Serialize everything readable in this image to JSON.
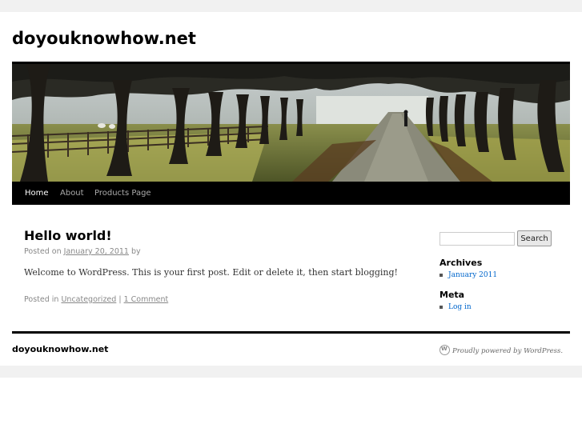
{
  "site": {
    "title": "doyouknowhow.net"
  },
  "nav": {
    "items": [
      {
        "label": "Home",
        "current": true
      },
      {
        "label": "About",
        "current": false
      },
      {
        "label": "Products Page",
        "current": false
      }
    ]
  },
  "post": {
    "title": "Hello world!",
    "posted_on_prefix": "Posted on",
    "date": "January 20, 2011",
    "by": "by",
    "body": "Welcome to WordPress. This is your first post. Edit or delete it, then start blogging!",
    "posted_in_prefix": "Posted in",
    "category": "Uncategorized",
    "separator": "|",
    "comments": "1 Comment"
  },
  "sidebar": {
    "search_button": "Search",
    "search_value": "",
    "archives_title": "Archives",
    "archives": [
      "January 2011"
    ],
    "meta_title": "Meta",
    "meta_links": [
      "Log in"
    ]
  },
  "footer": {
    "site_title": "doyouknowhow.net",
    "credit": "Proudly powered by WordPress."
  },
  "colors": {
    "nav_background": "#000000",
    "link_blue": "#0066cc",
    "band_gray": "#f1f1f1"
  },
  "icons": {
    "footer_credit_icon": "wordpress-logo-icon"
  }
}
